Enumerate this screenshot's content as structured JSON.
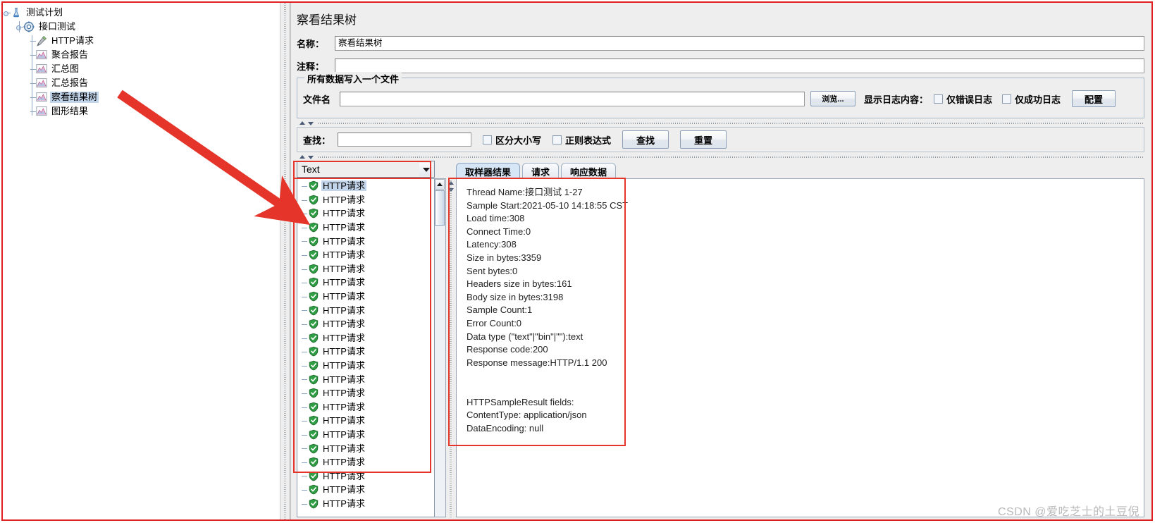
{
  "tree": {
    "nodes": [
      {
        "label": "测试计划",
        "icon": "test-plan-icon",
        "depth": 0,
        "selected": false,
        "expander": true
      },
      {
        "label": "接口测试",
        "icon": "thread-group-icon",
        "depth": 1,
        "selected": false,
        "expander": true
      },
      {
        "label": "HTTP请求",
        "icon": "http-request-icon",
        "depth": 2,
        "selected": false,
        "expander": false
      },
      {
        "label": "聚合报告",
        "icon": "listener-icon",
        "depth": 2,
        "selected": false,
        "expander": false
      },
      {
        "label": "汇总图",
        "icon": "listener-icon",
        "depth": 2,
        "selected": false,
        "expander": false
      },
      {
        "label": "汇总报告",
        "icon": "listener-icon",
        "depth": 2,
        "selected": false,
        "expander": false
      },
      {
        "label": "察看结果树",
        "icon": "listener-icon",
        "depth": 2,
        "selected": true,
        "expander": false
      },
      {
        "label": "图形结果",
        "icon": "listener-icon",
        "depth": 2,
        "selected": false,
        "expander": false
      }
    ]
  },
  "panel": {
    "title": "察看结果树",
    "name_label": "名称：",
    "name_value": "察看结果树",
    "comment_label": "注释：",
    "comment_value": "",
    "file_group_legend": "所有数据写入一个文件",
    "filename_label": "文件名",
    "filename_value": "",
    "browse_button": "浏览...",
    "log_display_label": "显示日志内容：",
    "errors_only_label": "仅错误日志",
    "errors_only_checked": false,
    "success_only_label": "仅成功日志",
    "success_only_checked": false,
    "configure_button": "配置"
  },
  "search": {
    "label": "查找：",
    "value": "",
    "case_sensitive_label": "区分大小写",
    "case_sensitive_checked": false,
    "regex_label": "正则表达式",
    "regex_checked": false,
    "find_button": "查找",
    "reset_button": "重置"
  },
  "results": {
    "renderer_selected": "Text",
    "renderer_options": [
      "Text"
    ],
    "items": [
      {
        "label": "HTTP请求",
        "status": "success",
        "selected": true
      },
      {
        "label": "HTTP请求",
        "status": "success",
        "selected": false
      },
      {
        "label": "HTTP请求",
        "status": "success",
        "selected": false
      },
      {
        "label": "HTTP请求",
        "status": "success",
        "selected": false
      },
      {
        "label": "HTTP请求",
        "status": "success",
        "selected": false
      },
      {
        "label": "HTTP请求",
        "status": "success",
        "selected": false
      },
      {
        "label": "HTTP请求",
        "status": "success",
        "selected": false
      },
      {
        "label": "HTTP请求",
        "status": "success",
        "selected": false
      },
      {
        "label": "HTTP请求",
        "status": "success",
        "selected": false
      },
      {
        "label": "HTTP请求",
        "status": "success",
        "selected": false
      },
      {
        "label": "HTTP请求",
        "status": "success",
        "selected": false
      },
      {
        "label": "HTTP请求",
        "status": "success",
        "selected": false
      },
      {
        "label": "HTTP请求",
        "status": "success",
        "selected": false
      },
      {
        "label": "HTTP请求",
        "status": "success",
        "selected": false
      },
      {
        "label": "HTTP请求",
        "status": "success",
        "selected": false
      },
      {
        "label": "HTTP请求",
        "status": "success",
        "selected": false
      },
      {
        "label": "HTTP请求",
        "status": "success",
        "selected": false
      },
      {
        "label": "HTTP请求",
        "status": "success",
        "selected": false
      },
      {
        "label": "HTTP请求",
        "status": "success",
        "selected": false
      },
      {
        "label": "HTTP请求",
        "status": "success",
        "selected": false
      },
      {
        "label": "HTTP请求",
        "status": "success",
        "selected": false
      },
      {
        "label": "HTTP请求",
        "status": "success",
        "selected": false
      },
      {
        "label": "HTTP请求",
        "status": "success",
        "selected": false
      },
      {
        "label": "HTTP请求",
        "status": "success",
        "selected": false
      }
    ]
  },
  "detail": {
    "tabs": [
      {
        "label": "取样器结果",
        "active": true
      },
      {
        "label": "请求",
        "active": false
      },
      {
        "label": "响应数据",
        "active": false
      }
    ],
    "sampler_result_text": "Thread Name:接口测试 1-27\nSample Start:2021-05-10 14:18:55 CST\nLoad time:308\nConnect Time:0\nLatency:308\nSize in bytes:3359\nSent bytes:0\nHeaders size in bytes:161\nBody size in bytes:3198\nSample Count:1\nError Count:0\nData type (\"text\"|\"bin\"|\"\"):text\nResponse code:200\nResponse message:HTTP/1.1 200\n\n\nHTTPSampleResult fields:\nContentType: application/json\nDataEncoding: null"
  },
  "watermark": "CSDN @爱吃芝士的土豆倪",
  "colors": {
    "annotation_red": "#e5352b",
    "selection_blue": "#c3d5ea",
    "panel_bg": "#eeeeee",
    "active_tab": "#d6e6f7",
    "success_green": "#2f9e44"
  }
}
